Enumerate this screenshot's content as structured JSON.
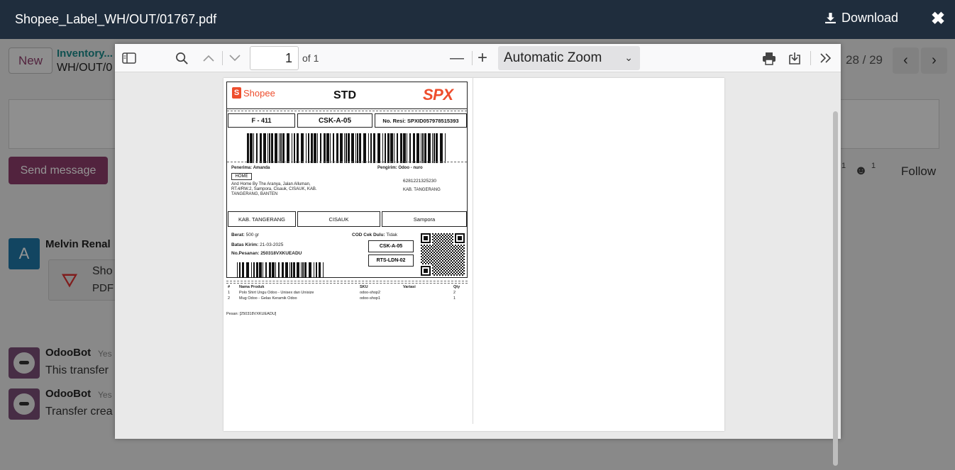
{
  "window": {
    "title": "Shopee_Label_WH/OUT/01767.pdf",
    "download_label": "Download",
    "download_icon": "download-icon",
    "close_icon": "close-icon"
  },
  "background": {
    "new_button": "New",
    "breadcrumb_parent": "Inventory...",
    "breadcrumb_current": "WH/OUT/0",
    "pager": "28 / 29",
    "send_message": "Send message",
    "follow": "Follow",
    "count_messages": "1",
    "count_followers": "1",
    "messages": [
      {
        "avatar": "A",
        "author": "Melvin Renal",
        "attachment_name": "Sho",
        "attachment_ext": "PDF"
      },
      {
        "author": "OdooBot",
        "time": "Yes",
        "text": "This transfer"
      },
      {
        "author": "OdooBot",
        "time": "Yes",
        "text": "Transfer crea"
      }
    ]
  },
  "viewer": {
    "page_number": "1",
    "page_of": "of 1",
    "zoom_label": "Automatic Zoom",
    "zoom_out": "—",
    "zoom_in": "+"
  },
  "label": {
    "brand": "Shopee",
    "service": "STD",
    "courier": "SPX",
    "sort_code": "F - 411",
    "station_code": "CSK-A-05",
    "resi": "No. Resi: SPXID057978515393",
    "receiver_label": "Penerima:",
    "receiver_name": "Amanda",
    "address_type": "HOME",
    "address_lines": [
      "And Home By The Aranya, Jalan Alluman,",
      "RT.4/RW.2, Sampora, Cisauk, CISAUK, KAB.",
      "TANGERANG, BANTEN"
    ],
    "sender_label": "Pengirim:",
    "sender_name": "Odoo - nuro",
    "sender_phone": "6281221325230",
    "sender_city": "KAB. TANGERANG",
    "city": "KAB. TANGERANG",
    "district": "CISAUK",
    "subdistrict": "Sampora",
    "weight_label": "Berat:",
    "weight": "500 gr",
    "cod_label": "COD Cek Dulu:",
    "cod_value": "Tidak",
    "deadline_label": "Batas Kirim:",
    "deadline": "21-03-2025",
    "order_label": "No.Pesanan:",
    "order_no": "250318VXKUEADU",
    "box_code1": "CSK-A-05",
    "box_code2": "RTS-LDN-02",
    "items_header": [
      "#",
      "Nama Produk",
      "SKU",
      "Variasi",
      "Qty"
    ],
    "items": [
      [
        "1",
        "Polo Shirt Ungu Odoo - Unisex dan Unisize",
        "odoo-shop2",
        "",
        "2"
      ],
      [
        "2",
        "Mug Odoo - Gelas Keramik Odoo",
        "odoo-shop1",
        "",
        "1"
      ]
    ],
    "note": "Pesan: [250318VXKUEADU]"
  },
  "colors": {
    "titlebar": "#1f2d3d",
    "odoo_primary": "#8e3d6b",
    "shopee_orange": "#ee4d2d"
  }
}
